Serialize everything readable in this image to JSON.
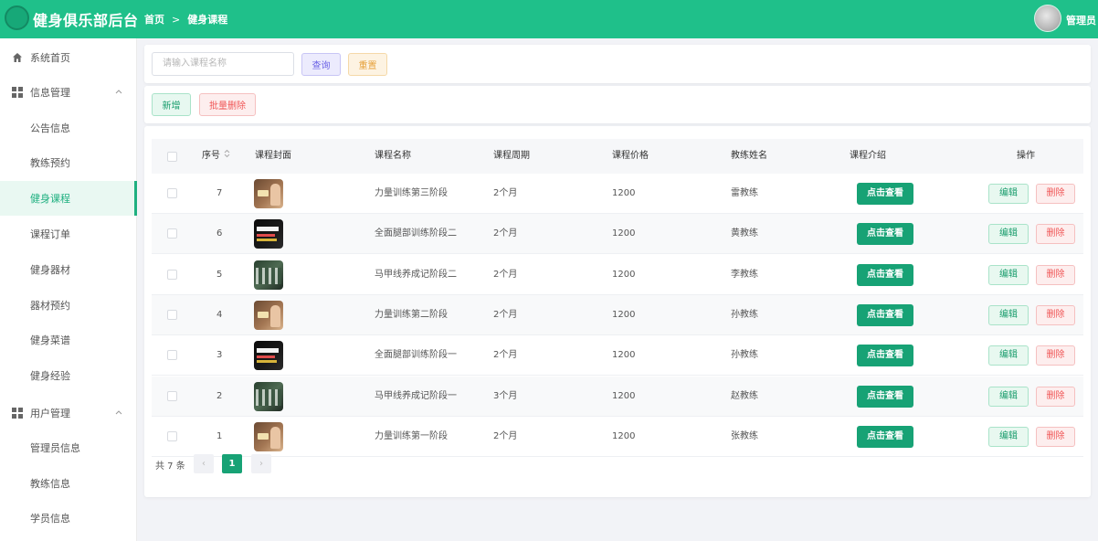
{
  "header": {
    "app_title": "健身俱乐部后台",
    "breadcrumb": [
      "首页",
      "健身课程"
    ],
    "breadcrumb_sep": ">",
    "user_name": "管理员"
  },
  "sidebar": {
    "items": [
      {
        "label": "系统首页",
        "icon": "home-icon"
      },
      {
        "label": "信息管理",
        "icon": "grid-icon",
        "expandable": true
      },
      {
        "label": "公告信息"
      },
      {
        "label": "教练预约"
      },
      {
        "label": "健身课程",
        "active": true
      },
      {
        "label": "课程订单"
      },
      {
        "label": "健身器材"
      },
      {
        "label": "器材预约"
      },
      {
        "label": "健身菜谱"
      },
      {
        "label": "健身经验"
      },
      {
        "label": "用户管理",
        "icon": "grid-icon",
        "expandable": true
      },
      {
        "label": "管理员信息"
      },
      {
        "label": "教练信息"
      },
      {
        "label": "学员信息"
      }
    ]
  },
  "search": {
    "placeholder": "请输入课程名称",
    "query_label": "查询",
    "reset_label": "重置"
  },
  "actions": {
    "add_label": "新增",
    "batch_delete_label": "批量删除"
  },
  "table": {
    "columns": [
      "序号",
      "课程封面",
      "课程名称",
      "课程周期",
      "课程价格",
      "教练姓名",
      "课程介绍",
      "操作"
    ],
    "rows": [
      {
        "no": "7",
        "cover": "A",
        "name": "力量训练第三阶段",
        "period": "2个月",
        "price": "1200",
        "coach": "雷教练"
      },
      {
        "no": "6",
        "cover": "B",
        "name": "全面腿部训练阶段二",
        "period": "2个月",
        "price": "1200",
        "coach": "黄教练"
      },
      {
        "no": "5",
        "cover": "C",
        "name": "马甲线养成记阶段二",
        "period": "2个月",
        "price": "1200",
        "coach": "李教练"
      },
      {
        "no": "4",
        "cover": "A",
        "name": "力量训练第二阶段",
        "period": "2个月",
        "price": "1200",
        "coach": "孙教练"
      },
      {
        "no": "3",
        "cover": "B",
        "name": "全面腿部训练阶段一",
        "period": "2个月",
        "price": "1200",
        "coach": "孙教练"
      },
      {
        "no": "2",
        "cover": "C",
        "name": "马甲线养成记阶段一",
        "period": "3个月",
        "price": "1200",
        "coach": "赵教练"
      },
      {
        "no": "1",
        "cover": "A",
        "name": "力量训练第一阶段",
        "period": "2个月",
        "price": "1200",
        "coach": "张教练"
      }
    ],
    "view_label": "点击查看",
    "edit_label": "编辑",
    "delete_label": "删除"
  },
  "pagination": {
    "total_text": "共 7 条",
    "current_page": "1",
    "prev": "‹",
    "next": "›"
  },
  "colors": {
    "brand": "#1fc08a",
    "primary_button": "#17a275"
  }
}
